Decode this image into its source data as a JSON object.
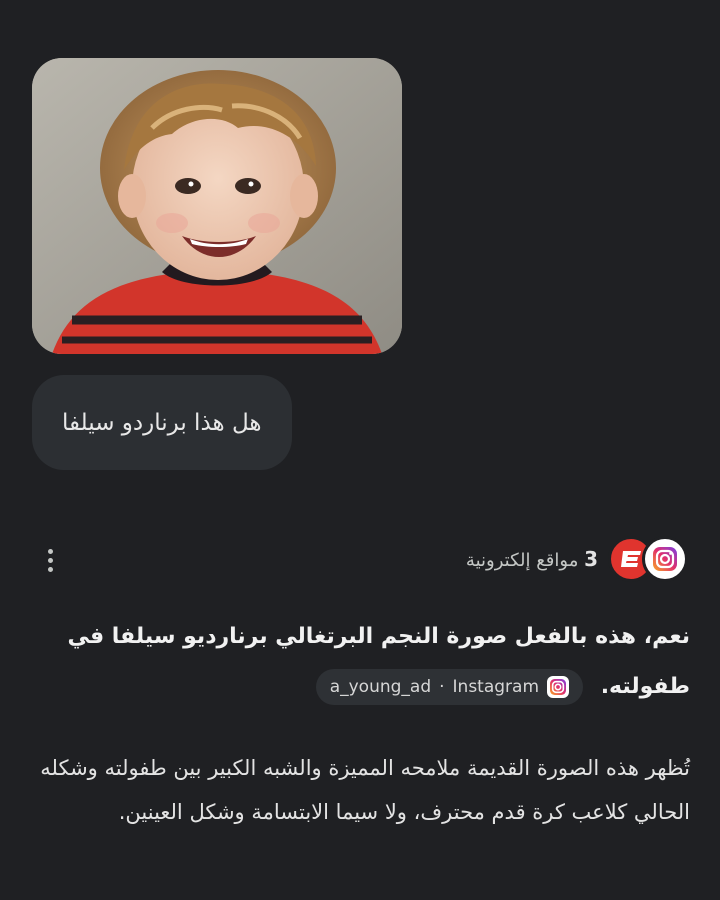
{
  "conversation": {
    "uploaded_image": {
      "subject": "childhood photo of a smiling toddler"
    },
    "user_message": "هل هذا برناردو سيلفا",
    "sources": {
      "count": "3",
      "label": "مواقع إلكترونية",
      "icons": [
        "espn-icon",
        "instagram-icon"
      ]
    },
    "answer": {
      "lead_text": "نعم، هذه بالفعل صورة النجم البرتغالي برنارديو سيلفا في طفولته.",
      "chip": {
        "platform": "Instagram",
        "separator": " · ",
        "account": "a_young_ad"
      },
      "body_text": "تُظهر هذه الصورة القديمة ملامحه المميزة والشبه الكبير بين طفولته وشكله الحالي كلاعب كرة قدم محترف، ولا سيما الابتسامة وشكل العينين."
    }
  },
  "colors": {
    "background": "#1f2023",
    "bubble": "#2c2f33",
    "chip": "#2e3135",
    "espn_red": "#e0342e"
  }
}
